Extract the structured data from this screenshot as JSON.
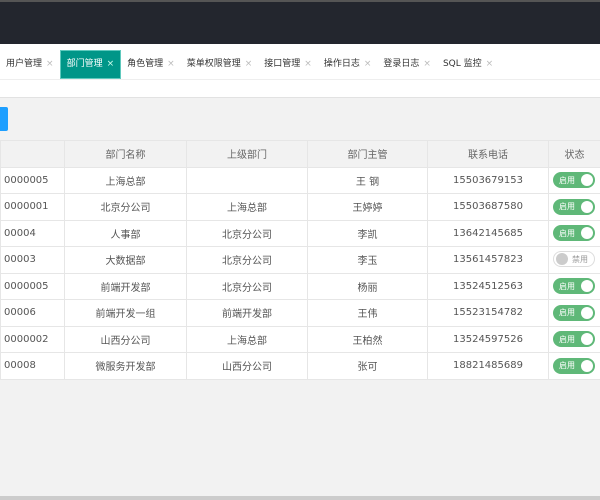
{
  "tabs": [
    {
      "label": "用户管理",
      "active": false
    },
    {
      "label": "部门管理",
      "active": true
    },
    {
      "label": "角色管理",
      "active": false
    },
    {
      "label": "菜单权限管理",
      "active": false
    },
    {
      "label": "接口管理",
      "active": false
    },
    {
      "label": "操作日志",
      "active": false
    },
    {
      "label": "登录日志",
      "active": false
    },
    {
      "label": "SQL 监控",
      "active": false
    }
  ],
  "close_glyph": "×",
  "table": {
    "headers": [
      "",
      "部门名称",
      "上级部门",
      "部门主管",
      "联系电话",
      "状态"
    ],
    "rows": [
      {
        "id": "0000005",
        "name": "上海总部",
        "parent": "",
        "head": "王 钢",
        "phone": "15503679153",
        "status": "启用",
        "on": true
      },
      {
        "id": "0000001",
        "name": "北京分公司",
        "parent": "上海总部",
        "head": "王婷婷",
        "phone": "15503687580",
        "status": "启用",
        "on": true
      },
      {
        "id": "00004",
        "name": "人事部",
        "parent": "北京分公司",
        "head": "李凯",
        "phone": "13642145685",
        "status": "启用",
        "on": true
      },
      {
        "id": "00003",
        "name": "大数据部",
        "parent": "北京分公司",
        "head": "李玉",
        "phone": "13561457823",
        "status": "禁用",
        "on": false
      },
      {
        "id": "0000005",
        "name": "前端开发部",
        "parent": "北京分公司",
        "head": "杨丽",
        "phone": "13524512563",
        "status": "启用",
        "on": true
      },
      {
        "id": "00006",
        "name": "前端开发一组",
        "parent": "前端开发部",
        "head": "王伟",
        "phone": "15523154782",
        "status": "启用",
        "on": true
      },
      {
        "id": "0000002",
        "name": "山西分公司",
        "parent": "上海总部",
        "head": "王柏然",
        "phone": "13524597526",
        "status": "启用",
        "on": true
      },
      {
        "id": "00008",
        "name": "微服务开发部",
        "parent": "山西分公司",
        "head": "张可",
        "phone": "18821485689",
        "status": "启用",
        "on": true
      }
    ]
  },
  "colors": {
    "topbar": "#23262e",
    "active_tab": "#009688",
    "switch_on": "#5fb878",
    "button": "#1e9fff"
  }
}
